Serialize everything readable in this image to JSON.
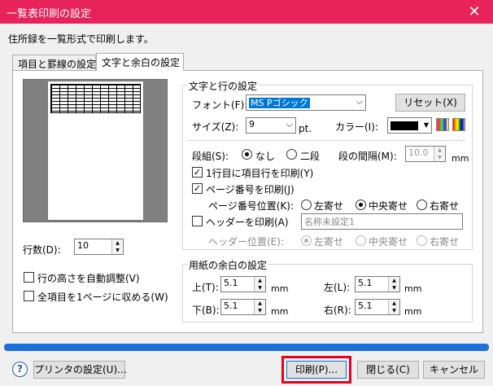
{
  "window": {
    "title": "一覧表印刷の設定",
    "close": "✕"
  },
  "description": "住所録を一覧形式で印刷します。",
  "tabs": [
    "項目と罫線の設定",
    "文字と余白の設定"
  ],
  "left": {
    "rows_label": "行数(D):",
    "rows_value": "10",
    "auto_height": "行の高さを自動調整(V)",
    "fit_one_page": "全項目を1ページに収める(W)"
  },
  "text": {
    "group_label": "文字と行の設定",
    "font_label": "フォント(F):",
    "font_value": "MS Pゴシック",
    "reset": "リセット(X)",
    "size_label": "サイズ(Z):",
    "size_value": "9",
    "size_unit": "pt.",
    "color_label": "カラー(I):",
    "columns_label": "段組(S):",
    "col_none": "なし",
    "col_two": "二段",
    "gap_label": "段の間隔(M):",
    "gap_value": "10.0",
    "gap_unit": "mm",
    "header_row": "1行目に項目行を印刷(Y)",
    "page_number": "ページ番号を印刷(J)",
    "page_pos_label": "ページ番号位置(K):",
    "pos_left": "左寄せ",
    "pos_center": "中央寄せ",
    "pos_right": "右寄せ",
    "print_header": "ヘッダーを印刷(A)",
    "header_value": "名称未設定1",
    "header_pos_label": "ヘッダー位置(E):"
  },
  "margins": {
    "group_label": "用紙の余白の設定",
    "top_label": "上(T):",
    "top": "5.1",
    "bottom_label": "下(B):",
    "bottom": "5.1",
    "left_label": "左(L):",
    "left": "5.1",
    "right_label": "右(R):",
    "right": "5.1",
    "unit": "mm"
  },
  "buttons": {
    "help": "?",
    "printer": "プリンタの設定(U)...",
    "print": "印刷(P)...",
    "close": "閉じる(C)",
    "cancel": "キャンセル"
  },
  "colors": {
    "title_bar": "#e8225a",
    "highlight": "#e8001c",
    "progress": "#1e6fd9"
  }
}
